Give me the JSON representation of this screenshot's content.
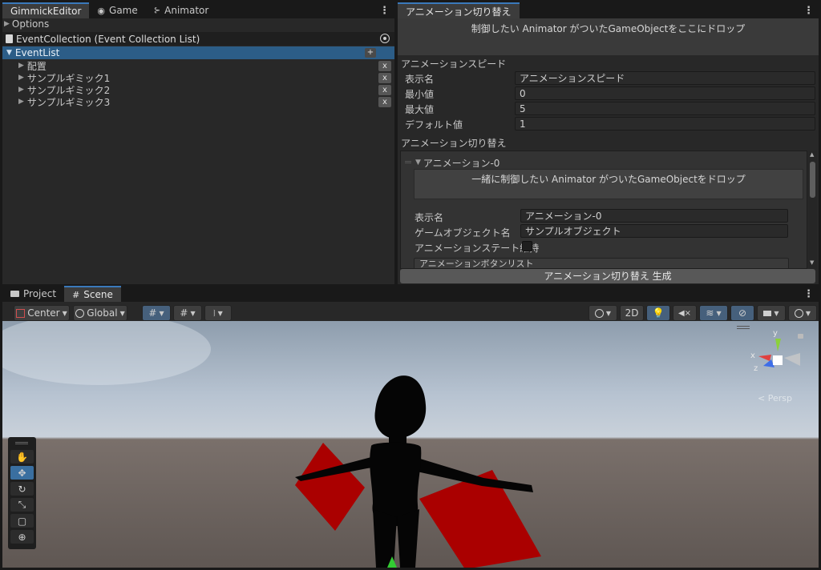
{
  "gimmick": {
    "tabs": [
      {
        "label": "GimmickEditor"
      },
      {
        "label": "Game"
      },
      {
        "label": "Animator"
      }
    ],
    "options_label": "Options",
    "collection_title": "EventCollection (Event Collection List)",
    "eventlist_label": "EventList",
    "add_label": "+",
    "items": [
      {
        "label": "配置"
      },
      {
        "label": "サンプルギミック1"
      },
      {
        "label": "サンプルギミック2"
      },
      {
        "label": "サンプルギミック3"
      }
    ],
    "remove_label": "x"
  },
  "anim": {
    "tab_label": "アニメーション切り替え",
    "drop_hint": "制御したい Animator がついたGameObjectをここにドロップ",
    "speed_section": "アニメーションスピード",
    "fields": {
      "display_name_label": "表示名",
      "display_name_value": "アニメーションスピード",
      "min_label": "最小値",
      "min_value": "0",
      "max_label": "最大値",
      "max_value": "5",
      "default_label": "デフォルト値",
      "default_value": "1"
    },
    "switch_section": "アニメーション切り替え",
    "entry": {
      "title": "アニメーション-0",
      "drop_hint": "一緒に制御したい Animator がついたGameObjectをドロップ",
      "display_name_label": "表示名",
      "display_name_value": "アニメーション-0",
      "object_name_label": "ゲームオブジェクト名",
      "object_name_value": "サンプルオブジェクト",
      "keep_state_label": "アニメーションステート維持",
      "button_list_label": "アニメーションボタンリスト"
    },
    "generate_button": "アニメーション切り替え 生成"
  },
  "scene": {
    "tabs": [
      {
        "label": "Project"
      },
      {
        "label": "Scene"
      }
    ],
    "pivot_label": "Center",
    "space_label": "Global",
    "mode_2d_label": "2D",
    "persp_label": "< Persp",
    "gizmo_axes": {
      "x": "x",
      "y": "y",
      "z": "z"
    }
  },
  "colors": {
    "accent": "#3a79bb",
    "selection": "#2c5d87",
    "red_plane": "#aa0000",
    "sky": "#c2ccd8",
    "ground": "#5f5753"
  }
}
